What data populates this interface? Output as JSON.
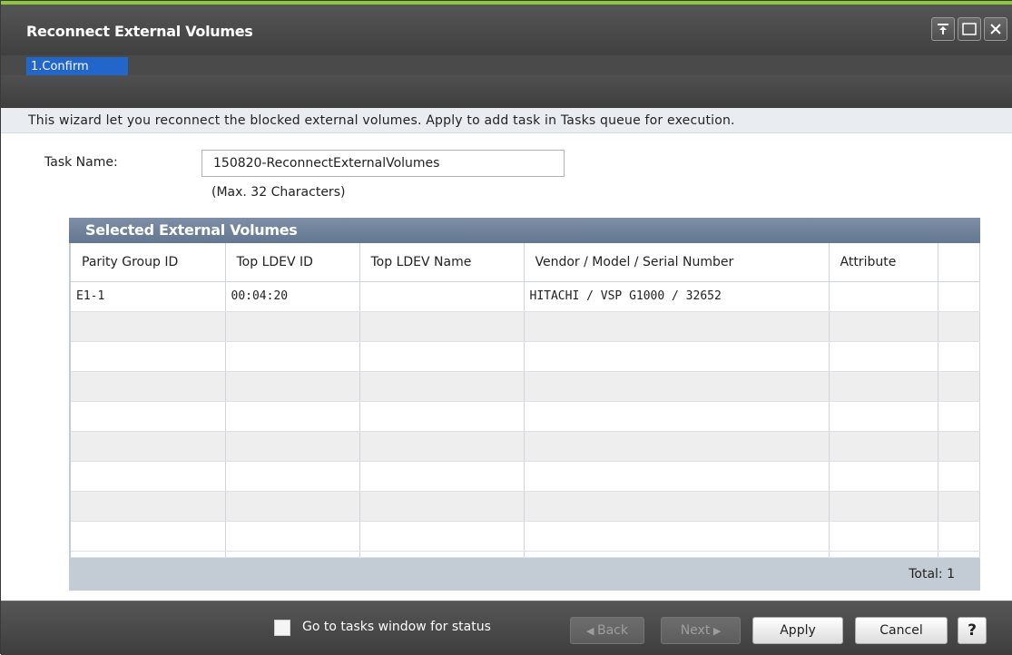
{
  "window": {
    "title": "Reconnect External Volumes",
    "controls": [
      "pin-icon",
      "maximize-icon",
      "close-icon"
    ]
  },
  "wizard": {
    "steps": [
      {
        "label": "1.Confirm",
        "active": true
      }
    ]
  },
  "description": "This wizard let you reconnect the blocked external volumes. Apply to add task in Tasks queue for execution.",
  "task": {
    "label": "Task Name:",
    "value": "150820-ReconnectExternalVolumes",
    "hint": "(Max. 32 Characters)"
  },
  "panel": {
    "title": "Selected External Volumes",
    "columns": [
      "Parity Group ID",
      "Top LDEV ID",
      "Top LDEV Name",
      "Vendor / Model / Serial Number",
      "Attribute",
      ""
    ],
    "rows": [
      [
        "E1-1",
        "00:04:20",
        "",
        "HITACHI / VSP G1000 / 32652",
        "",
        ""
      ],
      [
        "",
        "",
        "",
        "",
        "",
        ""
      ],
      [
        "",
        "",
        "",
        "",
        "",
        ""
      ],
      [
        "",
        "",
        "",
        "",
        "",
        ""
      ],
      [
        "",
        "",
        "",
        "",
        "",
        ""
      ],
      [
        "",
        "",
        "",
        "",
        "",
        ""
      ],
      [
        "",
        "",
        "",
        "",
        "",
        ""
      ],
      [
        "",
        "",
        "",
        "",
        "",
        ""
      ],
      [
        "",
        "",
        "",
        "",
        "",
        ""
      ]
    ],
    "total": "Total:  1"
  },
  "footer": {
    "checkbox_label": "Go to tasks window for status",
    "checkbox_checked": false,
    "back_label": "Back",
    "next_label": "Next",
    "apply_label": "Apply",
    "cancel_label": "Cancel",
    "help_label": "?"
  },
  "colors": {
    "accent": "#8dc63f",
    "step_active": "#2266cc",
    "panel_header": "#6f819b"
  }
}
